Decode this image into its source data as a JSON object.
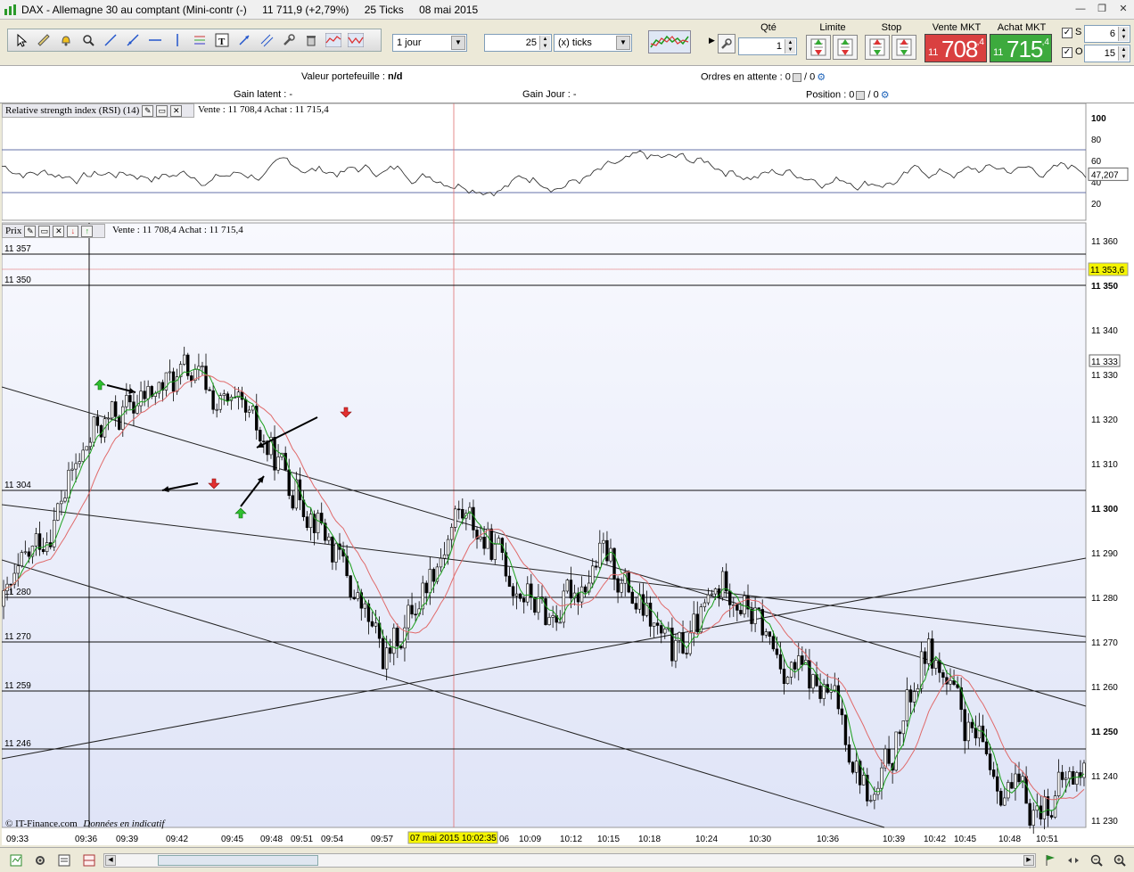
{
  "window": {
    "title_instrument": "DAX - Allemagne 30 au comptant (Mini-contr (-)",
    "title_price": "11 711,9 (+2,79%)",
    "title_ticks": "25 Ticks",
    "title_date": "08 mai 2015"
  },
  "toolbar": {
    "period_value": "1 jour",
    "ticks_count": "25",
    "ticks_unit": "(x) ticks",
    "qty_label": "Qté",
    "qty_value": "1",
    "limit_label": "Limite",
    "stop_label": "Stop",
    "sell_label": "Vente MKT",
    "buy_label": "Achat MKT",
    "sell_small": "11",
    "sell_big": "708",
    "sell_sup": ",4",
    "buy_small": "11",
    "buy_big": "715",
    "buy_sup": ",4",
    "s_label": "S",
    "s_value": "6",
    "o_label": "O",
    "o_value": "15"
  },
  "info": {
    "portfolio_label": "Valeur portefeuille :",
    "portfolio_value": "n/d",
    "pending_label": "Ordres en attente : 0",
    "pending_sep": "/ 0",
    "gain_latent": "Gain latent : -",
    "gain_jour": "Gain Jour : -",
    "position_label": "Position : 0",
    "position_sep": "/ 0"
  },
  "rsi_panel": {
    "title": "Relative strength index (RSI) (14)",
    "quote": "Vente : 11 708,4 Achat : 11 715,4",
    "axis": [
      "100",
      "80",
      "60",
      "40",
      "20"
    ],
    "current": "47,207"
  },
  "price_panel": {
    "title": "Prix",
    "quote": "Vente : 11 708,4 Achat : 11 715,4",
    "axis": [
      "11 360",
      "11 350",
      "11 340",
      "11 333",
      "11 330",
      "11 320",
      "11 310",
      "11 300",
      "11 290",
      "11 280",
      "11 270",
      "11 260",
      "11 250",
      "11 240",
      "11 230"
    ],
    "bold_axis": [
      "11 350",
      "11 300",
      "11 250"
    ],
    "marker": "11 353,6",
    "hline_labels": [
      "11 357",
      "11 350",
      "11 304",
      "11 280",
      "11 270",
      "11 259",
      "11 246"
    ],
    "time_labels": [
      "09:33",
      "09:36",
      "09:39",
      "09:42",
      "09:45",
      "09:48",
      "09:51",
      "09:54",
      "09:57",
      "06",
      "10:09",
      "10:12",
      "10:15",
      "10:18",
      "10:24",
      "10:30",
      "10:36",
      "10:39",
      "10:42",
      "10:45",
      "10:48",
      "10:51"
    ],
    "cursor_time": "07 mai 2015 10:02:35",
    "copyright": "© IT-Finance.com",
    "disclaimer": "Données en indicatif"
  },
  "colors": {
    "sell": "#d94040",
    "buy": "#3daa3d",
    "sma_fast": "#1aa01a",
    "sma_slow": "#e06a6a",
    "chart_bg": "#eaedf9",
    "marker_bg": "#f5f500"
  }
}
